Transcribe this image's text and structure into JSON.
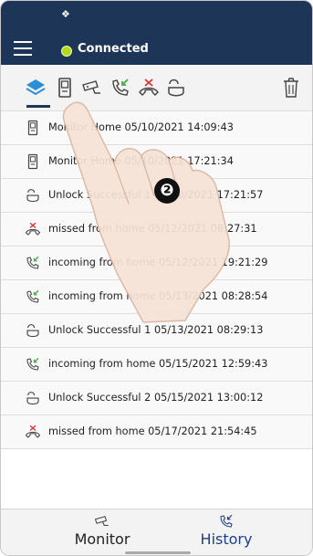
{
  "header": {
    "status_text": "Connected",
    "status_color": "#b6d81e",
    "brand_color": "#1d3557"
  },
  "toolbar": {
    "filters": [
      {
        "icon": "layers-icon",
        "active": true
      },
      {
        "icon": "door-station-icon"
      },
      {
        "icon": "cctv-camera-icon"
      },
      {
        "icon": "incoming-call-icon"
      },
      {
        "icon": "missed-call-icon"
      },
      {
        "icon": "unlock-icon"
      }
    ],
    "delete_icon": "trash-icon"
  },
  "records": [
    {
      "icon": "door-station-icon",
      "text": "Monitor Home 05/10/2021 14:09:43"
    },
    {
      "icon": "door-station-icon",
      "text": "Monitor Home 05/10/2021 17:21:34"
    },
    {
      "icon": "unlock-icon",
      "text": "Unlock Successful 1 05/10/2021 17:21:57"
    },
    {
      "icon": "missed-call-icon",
      "text": "missed  from home 05/12/2021 08:27:31"
    },
    {
      "icon": "incoming-call-icon",
      "text": "incoming  from home 05/12/2021 19:21:29"
    },
    {
      "icon": "incoming-call-icon",
      "text": "incoming  from home 05/13/2021 08:28:54"
    },
    {
      "icon": "unlock-icon",
      "text": "Unlock Successful 1 05/13/2021 08:29:13"
    },
    {
      "icon": "incoming-call-icon",
      "text": "incoming  from home 05/15/2021 12:59:43"
    },
    {
      "icon": "unlock-icon",
      "text": "Unlock Successful 2 05/15/2021 13:00:12"
    },
    {
      "icon": "missed-call-icon",
      "text": "missed  from home 05/17/2021 21:54:45"
    }
  ],
  "bottom_nav": {
    "monitor_label": "Monitor",
    "history_label": "History",
    "active": "history"
  },
  "annotation": {
    "step_number": "❷"
  }
}
